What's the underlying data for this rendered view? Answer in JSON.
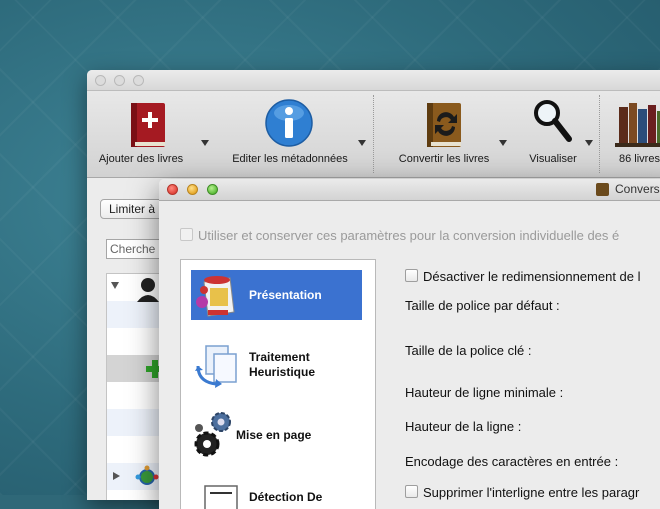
{
  "main_window": {
    "toolbar": [
      {
        "label": "Ajouter des livres",
        "icon": "add-book-icon",
        "has_menu": true
      },
      {
        "label": "Editer les métadonnées",
        "icon": "info-icon",
        "has_menu": true
      },
      {
        "label": "Convertir les livres",
        "icon": "convert-book-icon",
        "has_menu": true
      },
      {
        "label": "Visualiser",
        "icon": "magnifier-icon",
        "has_menu": true
      },
      {
        "label": "86 livres",
        "icon": "library-icon",
        "has_menu": false
      }
    ],
    "limit_button": "Limiter à",
    "search_placeholder": "Cherche"
  },
  "dialog": {
    "title": "Convers",
    "use_settings_checkbox": {
      "label": "Utiliser et conserver ces paramètres pour la conversion individuelle des é",
      "checked": false,
      "enabled": false
    },
    "sidebar": [
      {
        "label": "Présentation",
        "icon": "paint-bucket-icon",
        "selected": true
      },
      {
        "label": "Traitement Heuristique",
        "icon": "arrows-document-icon",
        "selected": false
      },
      {
        "label": "Mise en page",
        "icon": "gears-icon",
        "selected": false
      },
      {
        "label": "Détection De",
        "icon": "document-outline-icon",
        "selected": false
      }
    ],
    "fields": {
      "disable_resize": {
        "label": "Désactiver le redimensionnement de l",
        "checked": false
      },
      "default_font_size": "Taille de police par défaut :",
      "key_font_size": "Taille de la police clé :",
      "min_line_height": "Hauteur de ligne minimale :",
      "line_height": "Hauteur de la ligne :",
      "input_encoding": "Encodage des caractères en entrée :",
      "remove_spacing": {
        "label": "Supprimer l'interligne entre les paragr",
        "checked": false
      }
    }
  },
  "colors": {
    "selection": "#3b72d0",
    "desktop": "#2f6878"
  }
}
